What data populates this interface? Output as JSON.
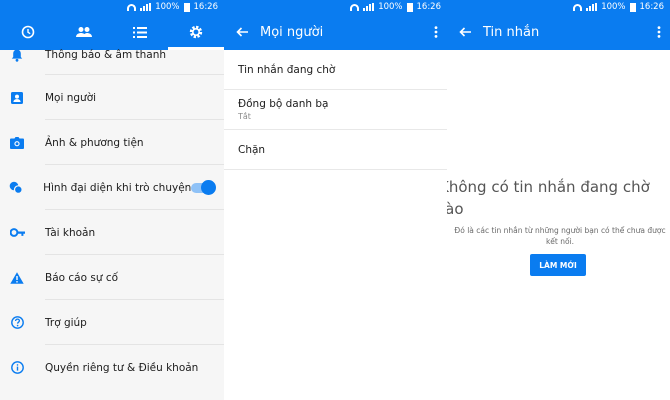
{
  "status_bar": {
    "battery": "100%",
    "time": "16:26"
  },
  "colors": {
    "accent": "#0a7cf0"
  },
  "settings_panel": {
    "tabs": [
      {
        "icon": "clock-icon"
      },
      {
        "icon": "people-icon"
      },
      {
        "icon": "list-icon"
      },
      {
        "icon": "gear-icon",
        "active": true
      }
    ],
    "items": [
      {
        "icon": "bell-icon",
        "label": "Thông báo & âm thanh"
      },
      {
        "icon": "person-card-icon",
        "label": "Mọi người"
      },
      {
        "icon": "camera-icon",
        "label": "Ảnh & phương tiện"
      },
      {
        "icon": "chat-heads-icon",
        "label": "Hình đại diện khi trò chuyện",
        "toggle_on": true
      },
      {
        "icon": "key-icon",
        "label": "Tài khoản"
      },
      {
        "icon": "warning-icon",
        "label": "Báo cáo sự cố"
      },
      {
        "icon": "help-icon",
        "label": "Trợ giúp"
      },
      {
        "icon": "info-icon",
        "label": "Quyền riêng tư & Điều khoản"
      }
    ]
  },
  "people_panel": {
    "title": "Mọi người",
    "items": [
      {
        "label": "Tin nhắn đang chờ"
      },
      {
        "label": "Đồng bộ danh bạ",
        "sublabel": "Tắt"
      },
      {
        "label": "Chặn"
      }
    ]
  },
  "messages_panel": {
    "title": "Tin nhắn",
    "empty_title": "Không có tin nhắn đang chờ\nrào",
    "empty_desc": "Đó là các tin nhắn từ những người bạn có thể chưa được kết nối.",
    "refresh_button": "LÀM MỚI"
  }
}
